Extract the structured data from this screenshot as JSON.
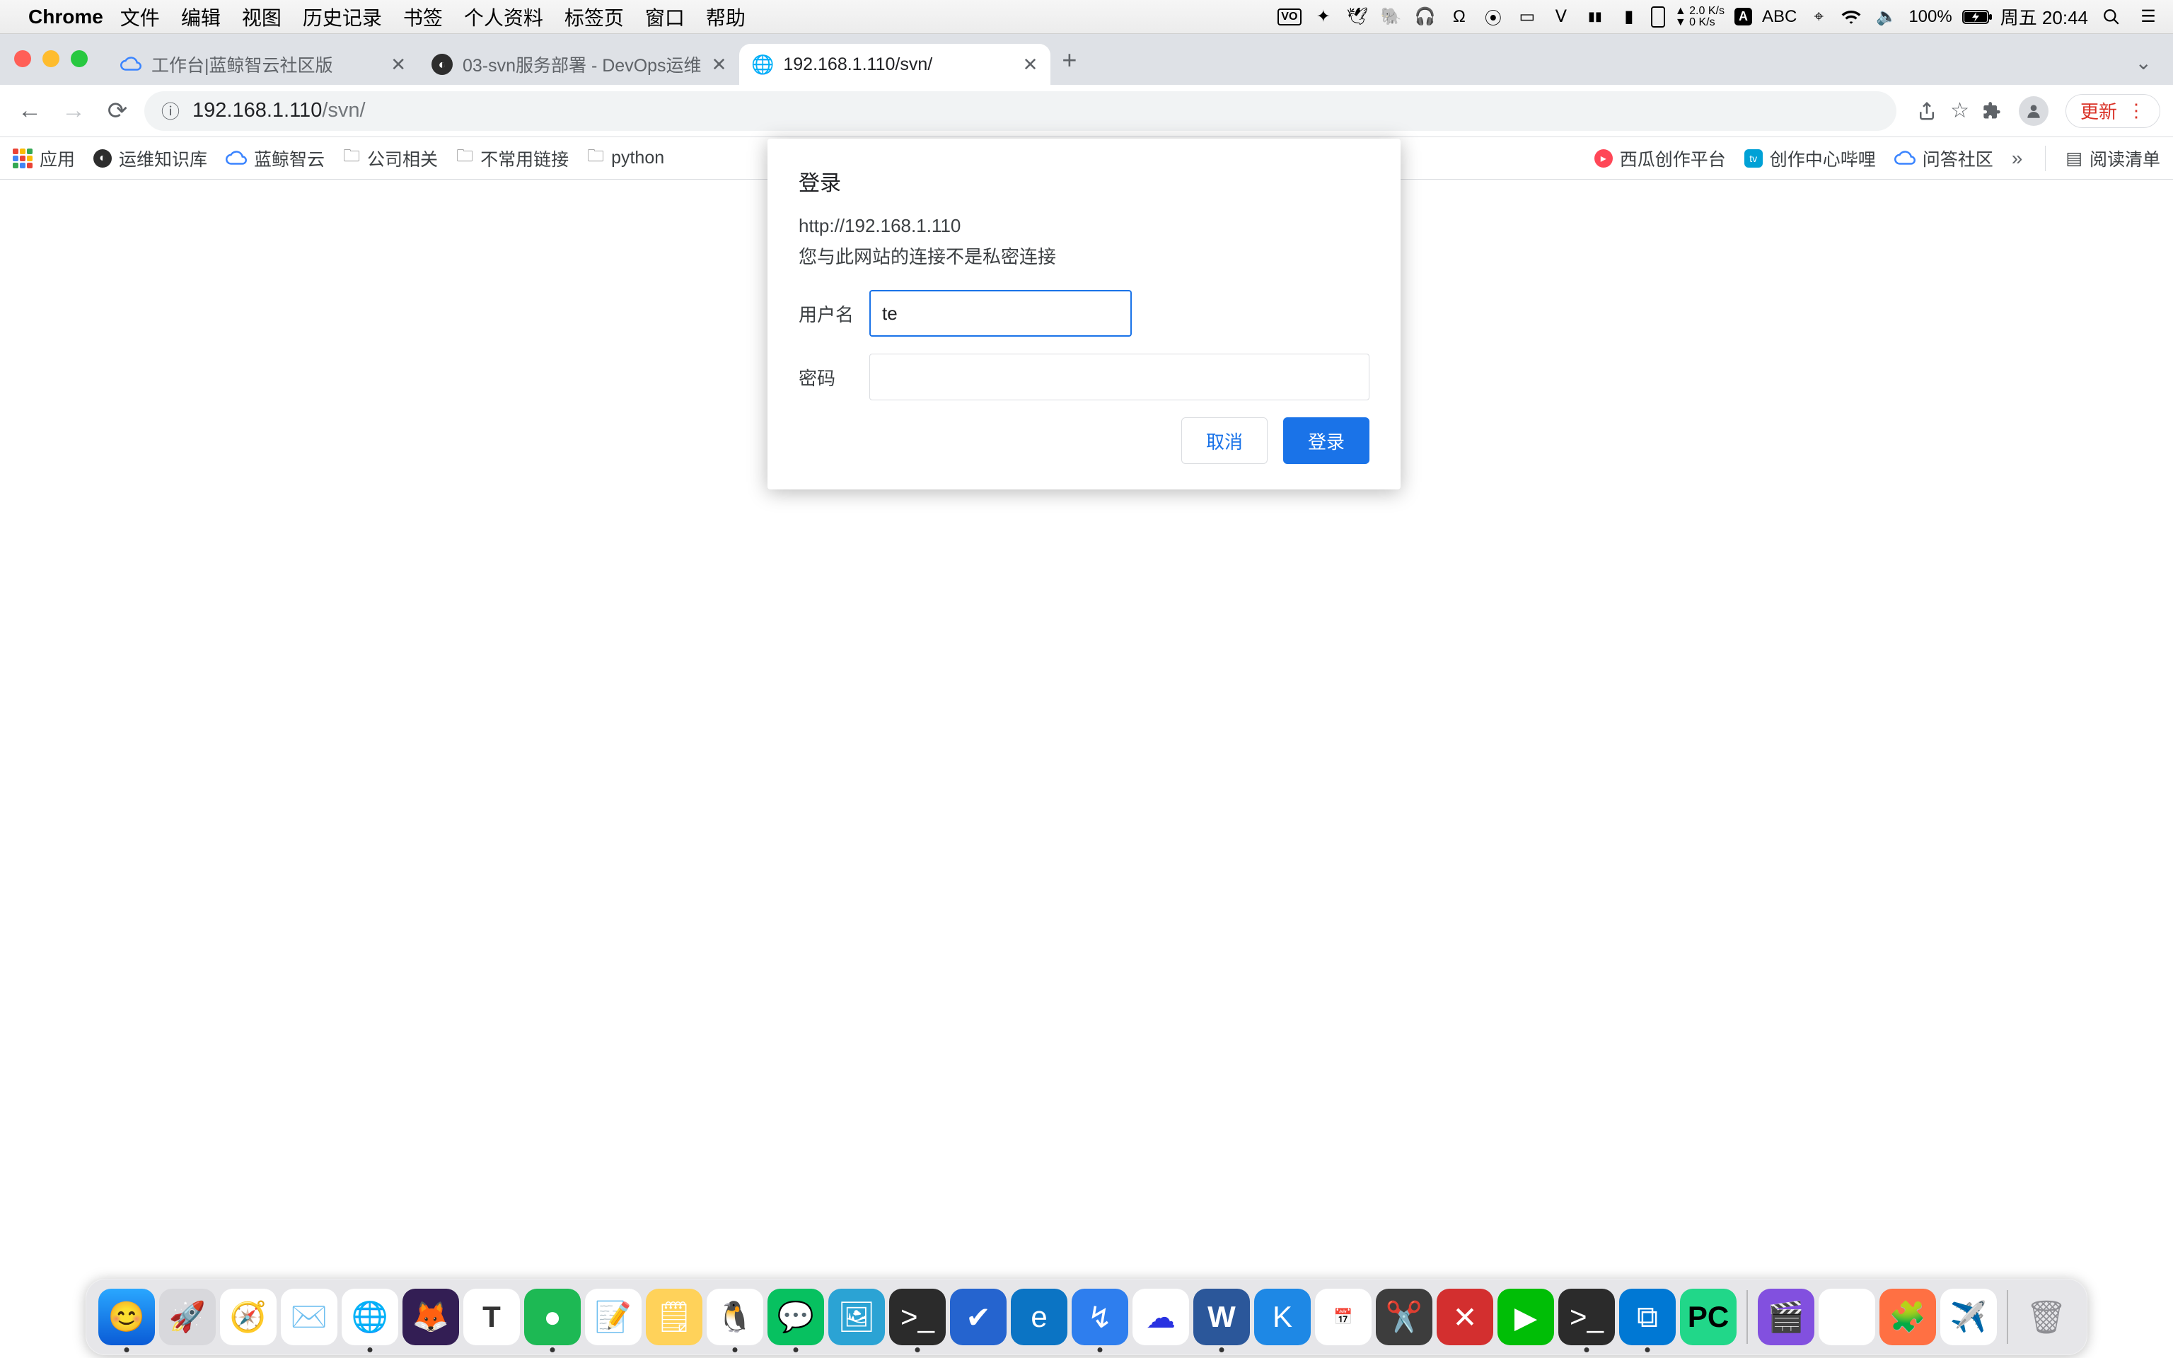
{
  "menubar": {
    "app_name": "Chrome",
    "items": [
      "文件",
      "编辑",
      "视图",
      "历史记录",
      "书签",
      "个人资料",
      "标签页",
      "窗口",
      "帮助"
    ],
    "net_up": "▲ 2.0 K/s",
    "net_down": "▼ 0 K/s",
    "input_label": "ABC",
    "battery": "100%",
    "clock": "周五 20:44"
  },
  "tabs": {
    "t1": "工作台|蓝鲸智云社区版",
    "t2": "03-svn服务部署 - DevOps运维",
    "t3": "192.168.1.110/svn/"
  },
  "omnibox": {
    "url_host": "192.168.1.110",
    "url_path": "/svn/"
  },
  "update_btn": "更新",
  "bookmarks": {
    "b0": "应用",
    "b1": "运维知识库",
    "b2": "蓝鲸智云",
    "b3": "公司相关",
    "b4": "不常用链接",
    "b5": "python",
    "b6": "西瓜创作平台",
    "b7": "创作中心哔哩",
    "b8": "问答社区",
    "readlist": "阅读清单"
  },
  "auth": {
    "title": "登录",
    "origin": "http://192.168.1.110",
    "warning": "您与此网站的连接不是私密连接",
    "label_user": "用户名",
    "label_pass": "密码",
    "value_user": "te",
    "cancel": "取消",
    "submit": "登录"
  },
  "traffic_colors": {
    "close": "#ff5f57",
    "min": "#febc2e",
    "max": "#28c840"
  }
}
